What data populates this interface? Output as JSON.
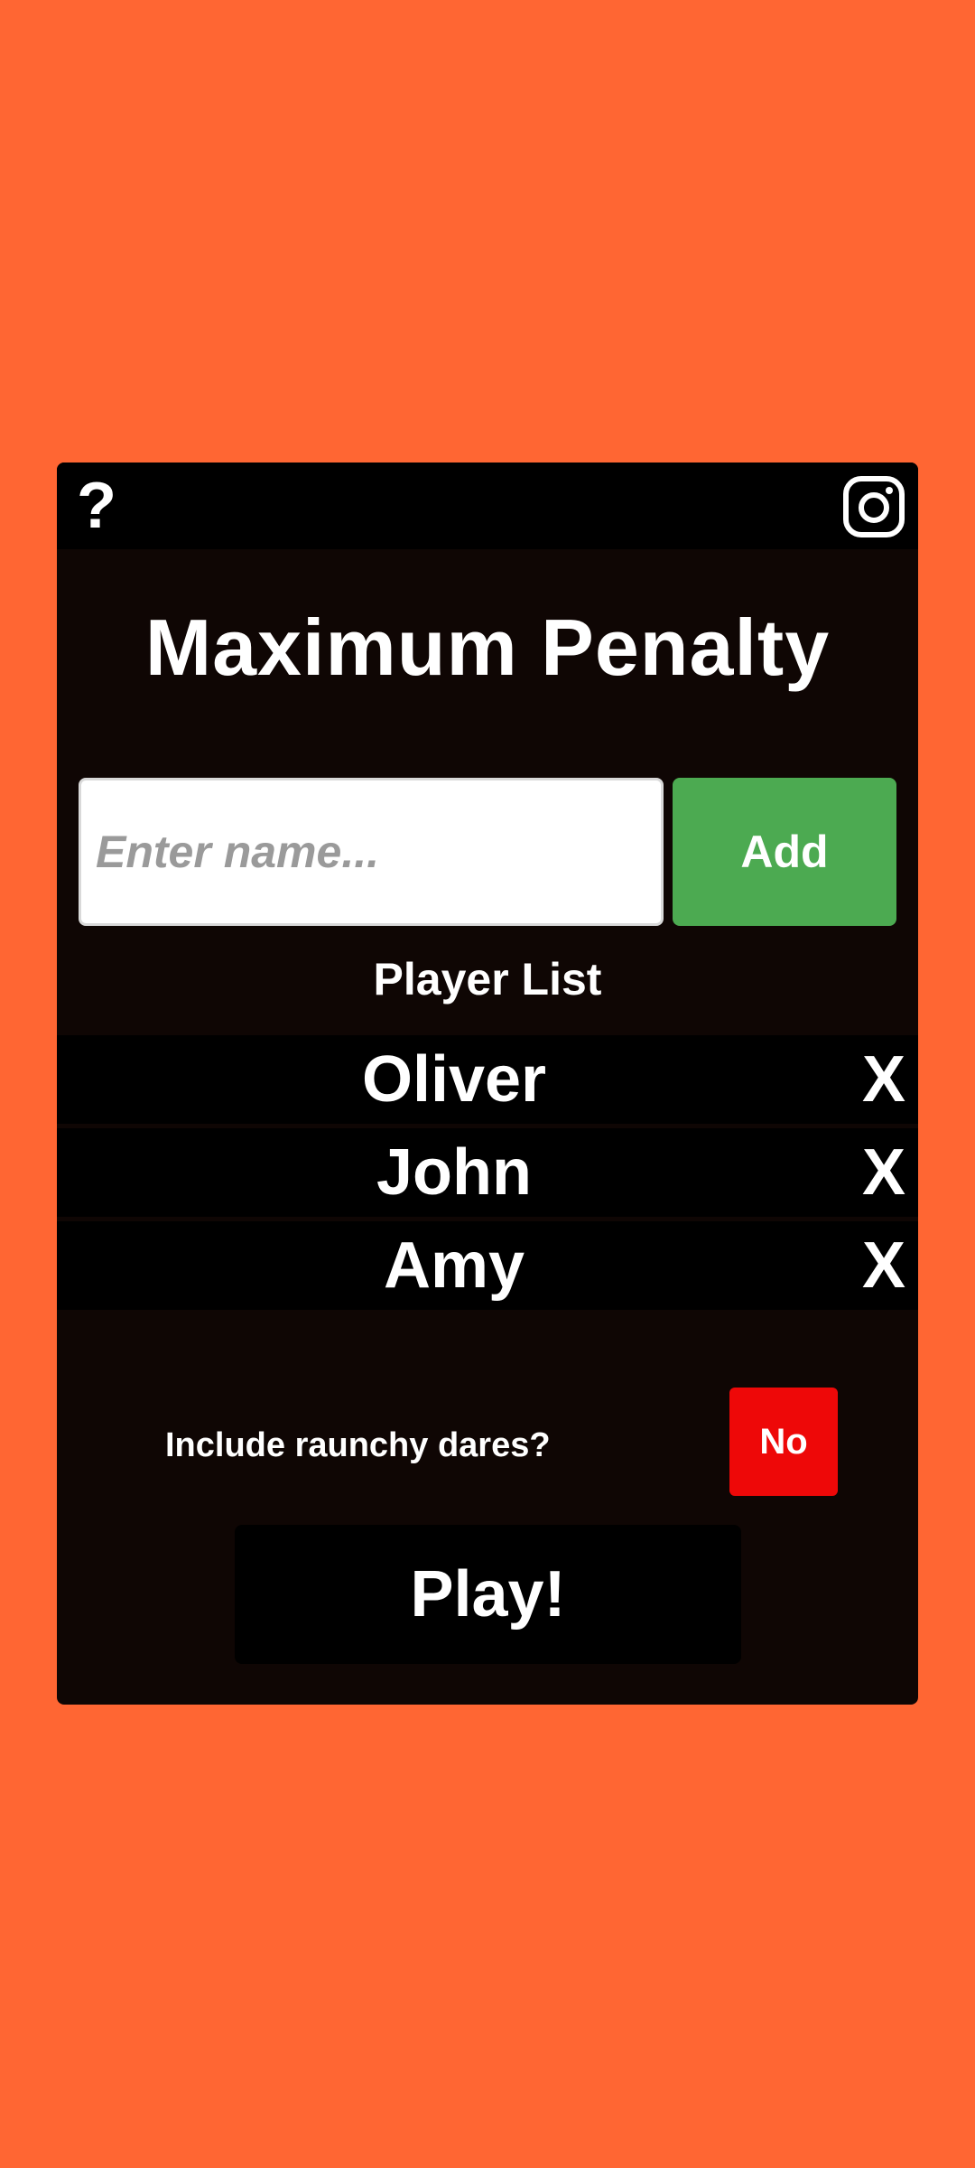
{
  "app": {
    "title": "Maximum Penalty"
  },
  "topbar": {
    "help_glyph": "?",
    "help_icon": "question-mark-icon",
    "social_icon": "instagram-icon"
  },
  "add_form": {
    "name_value": "",
    "name_placeholder": "Enter name...",
    "add_label": "Add"
  },
  "player_list": {
    "heading": "Player List",
    "remove_glyph": "X",
    "players": [
      {
        "name": "Oliver"
      },
      {
        "name": "John"
      },
      {
        "name": "Amy"
      }
    ]
  },
  "options": {
    "raunchy_label": "Include raunchy dares?",
    "raunchy_value": "No"
  },
  "play_label": "Play!",
  "colors": {
    "background": "#FF6633",
    "card": "#0F0604",
    "bar": "#000000",
    "add_button": "#4CAA51",
    "no_toggle": "#EE0808",
    "text": "#FFFFFF"
  }
}
